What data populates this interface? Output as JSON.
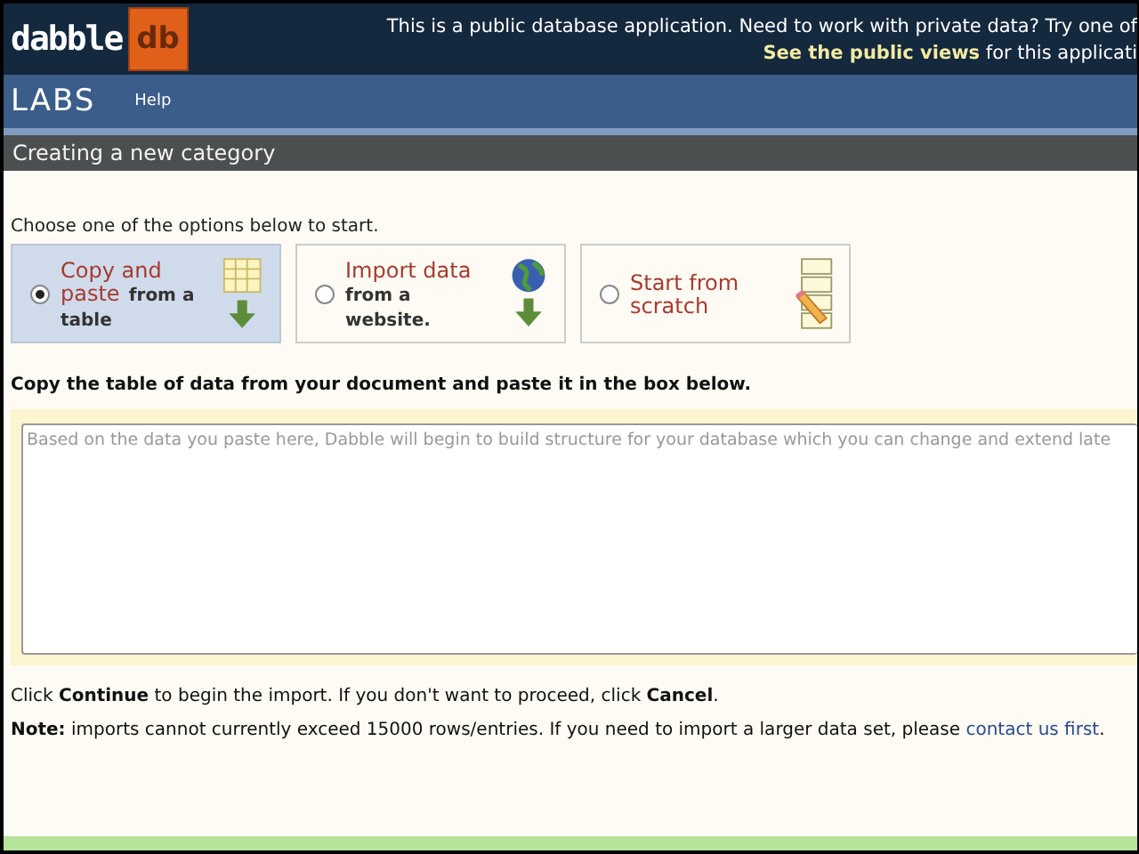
{
  "logo": {
    "word": "dabble",
    "badge": "db"
  },
  "notice": {
    "line": "This is a public database application. Need to work with private data? Try one of",
    "link": "See the public views",
    "rest": " for this applicati"
  },
  "nav": {
    "brand": "LABS",
    "items": [
      "Help"
    ]
  },
  "page_title": "Creating a new category",
  "intro": "Choose one of the options below to start.",
  "options": [
    {
      "title": "Copy and paste",
      "sub": "from a table",
      "selected": true,
      "kind": "table"
    },
    {
      "title": "Import data",
      "sub": "from a website.",
      "selected": false,
      "kind": "globe"
    },
    {
      "title": "Start from scratch",
      "selected": false,
      "kind": "scratch"
    }
  ],
  "instruction": "Copy the table of data from your document and paste it in the box below.",
  "paste_box": {
    "placeholder": "Based on the data you paste here, Dabble will begin to build structure for your database which you can change and extend late"
  },
  "help": "Click **Continue** to begin the import. If you don't want to proceed, click **Cancel**.",
  "note": {
    "text": "**Note:** imports cannot currently exceed 15000 rows/entries. If you need to import a larger data set, please ",
    "link": "contact us first",
    "after": "."
  }
}
